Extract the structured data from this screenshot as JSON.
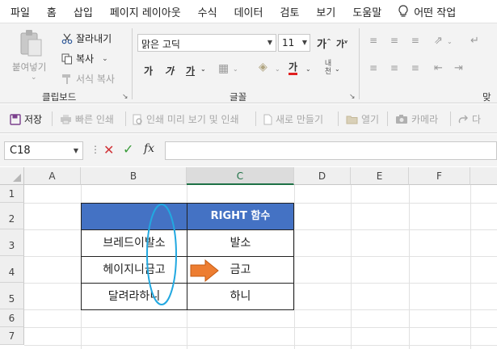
{
  "menu": [
    "파일",
    "홈",
    "삽입",
    "페이지 레이아웃",
    "수식",
    "데이터",
    "검토",
    "보기",
    "도움말"
  ],
  "menu_search": "어떤 작업",
  "ribbon": {
    "paste": "붙여넣기",
    "cut": "잘라내기",
    "copy": "복사",
    "format_painter": "서식 복사",
    "clipboard_group": "클립보드",
    "font_name": "맑은 고딕",
    "font_size": "11",
    "grow_font": "가",
    "shrink_font": "가",
    "bold": "가",
    "italic": "가",
    "underline": "가",
    "font_color_glyph": "가",
    "phonetic": "내천",
    "font_group": "글꼴",
    "align_group_partial": "맞"
  },
  "qat": {
    "save": "저장",
    "quick_print": "빠른 인쇄",
    "print_preview": "인쇄 미리 보기 및 인쇄",
    "new": "새로 만들기",
    "open": "열기",
    "camera": "카메라",
    "redo_partial": "다"
  },
  "formula_bar": {
    "name_box": "C18",
    "fx": "fx",
    "formula": ""
  },
  "grid": {
    "columns": [
      "A",
      "B",
      "C",
      "D",
      "E",
      "F"
    ],
    "selected_column": "C",
    "rows": [
      "1",
      "2",
      "3",
      "4",
      "5",
      "6",
      "7"
    ],
    "table": {
      "header": [
        "",
        "RIGHT 함수"
      ],
      "rows": [
        [
          "브레드이발소",
          "발소"
        ],
        [
          "헤이지니금고",
          "금고"
        ],
        [
          "달려라하니",
          "하니"
        ]
      ]
    }
  },
  "annotation": {
    "ellipse_color": "#22a8e0",
    "arrow_color": "#ed7d31"
  }
}
